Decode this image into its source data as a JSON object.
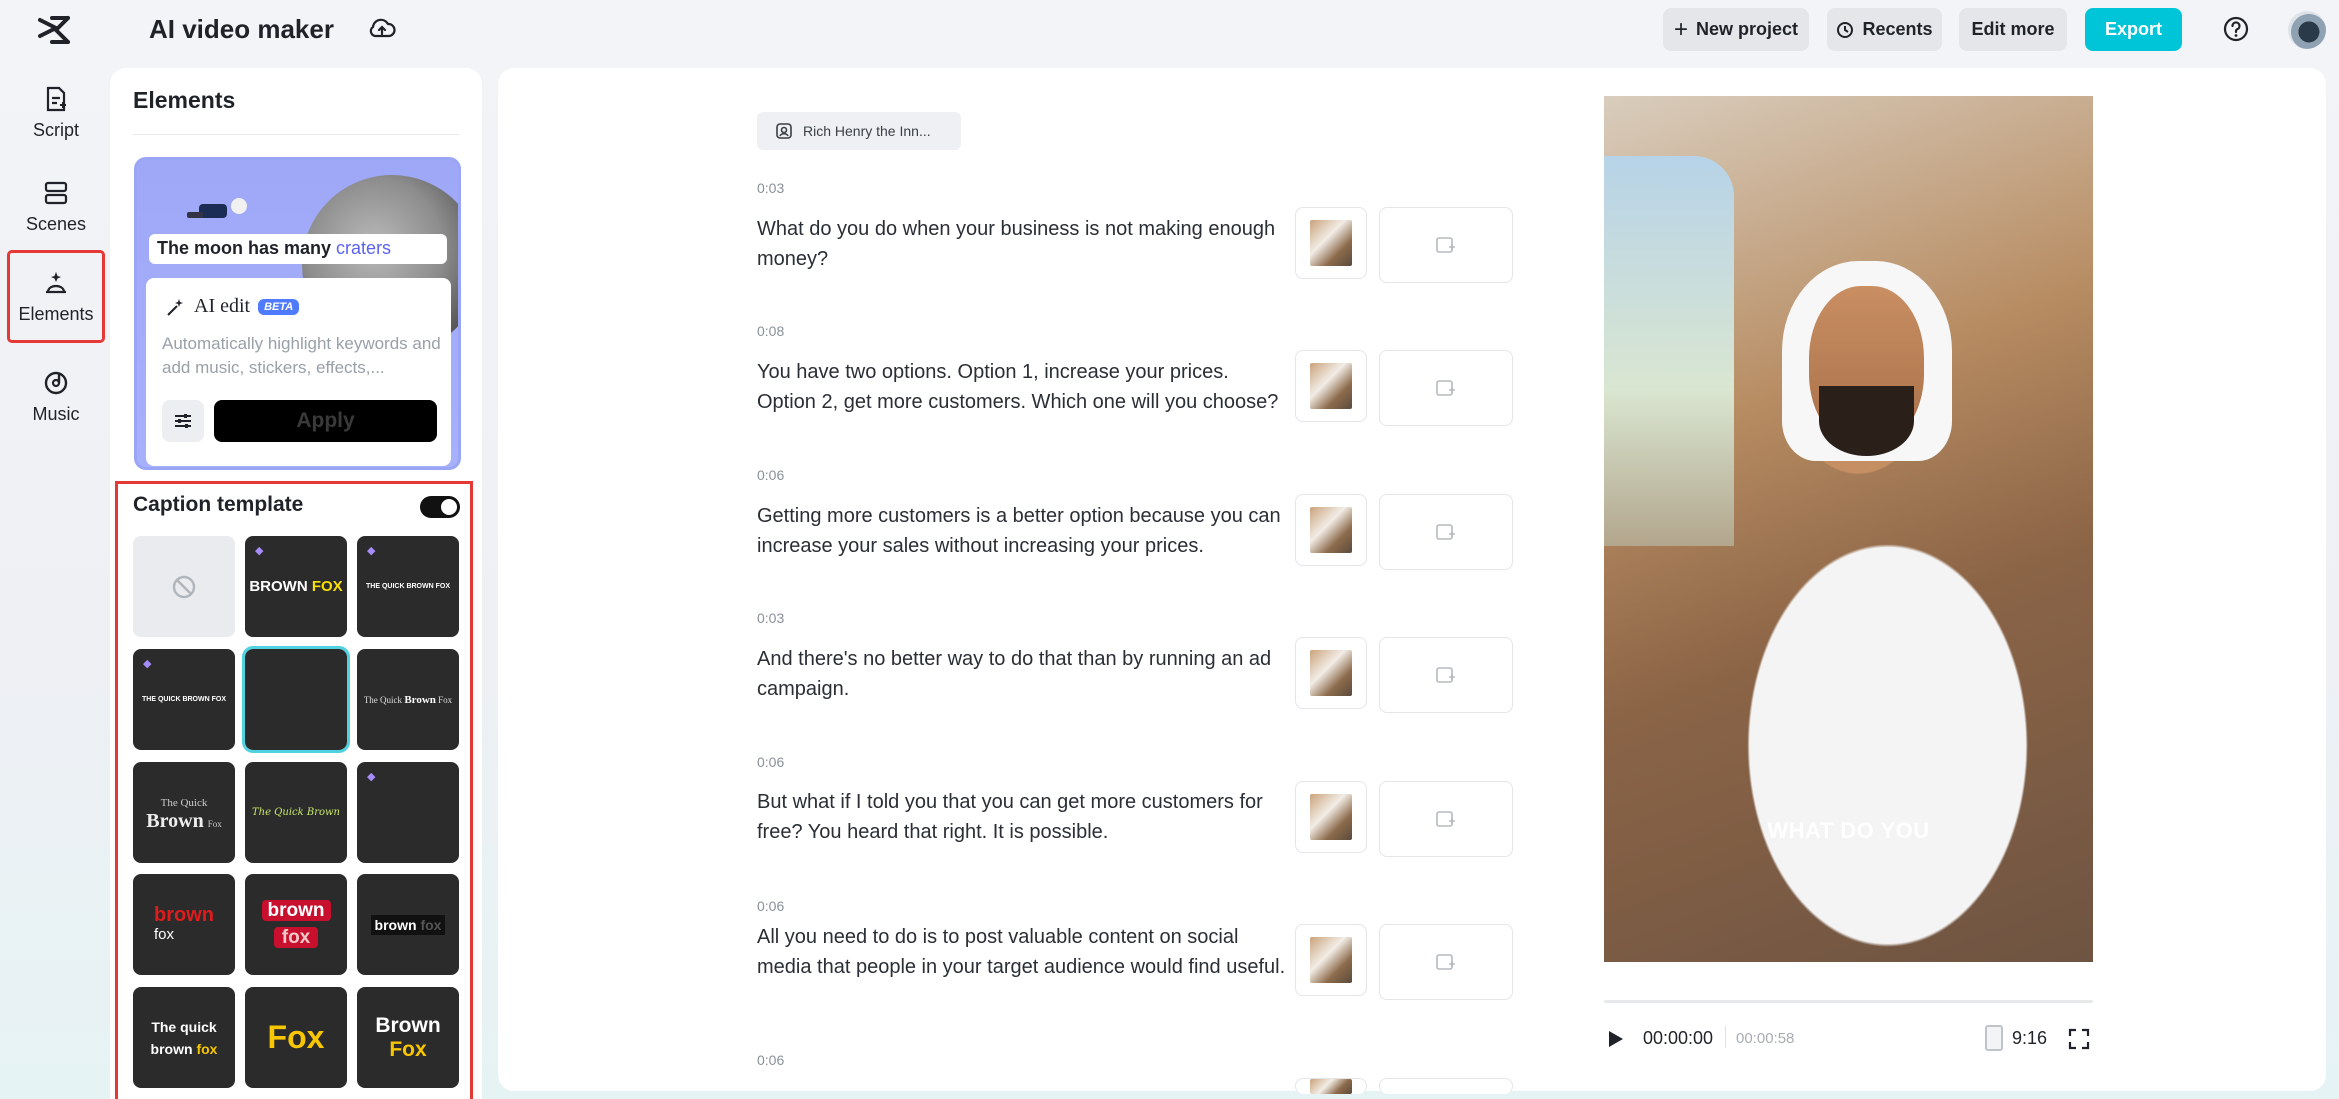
{
  "app": {
    "title": "AI video maker"
  },
  "topbar": {
    "new_project": "New project",
    "recents": "Recents",
    "edit_more": "Edit more",
    "export": "Export"
  },
  "rail": {
    "script": "Script",
    "scenes": "Scenes",
    "elements": "Elements",
    "music": "Music"
  },
  "elements_panel": {
    "title": "Elements",
    "ai_card": {
      "sample_text_before": "The moon has many ",
      "sample_text_highlight": "craters",
      "ai_edit_label": "AI edit",
      "beta_badge": "BETA",
      "description": "Automatically highlight keywords and add music, stickers, effects,...",
      "apply": "Apply"
    },
    "caption": {
      "title": "Caption template",
      "toggle_on": true,
      "templates": [
        {
          "label": "",
          "type": "none"
        },
        {
          "label": "BROWN FOX",
          "premium": true
        },
        {
          "label": "THE QUICK BROWN FOX",
          "premium": true
        },
        {
          "label": "THE QUICK BROWN FOX",
          "premium": true
        },
        {
          "label": "",
          "selected": true
        },
        {
          "label": "The Quick Brown Fox"
        },
        {
          "label": "The Quick Brown Fox"
        },
        {
          "label": "The Quick Brown"
        },
        {
          "label": "",
          "premium": true
        },
        {
          "label": "brown fox"
        },
        {
          "label": "brown fox"
        },
        {
          "label": "brown fox"
        },
        {
          "label": "The quick brown fox"
        },
        {
          "label": "Fox"
        },
        {
          "label": "Brown Fox"
        }
      ]
    }
  },
  "script": {
    "voice_chip": "Rich Henry the Inn...",
    "lines": [
      {
        "time": "0:03",
        "text": "What do you do when your business is not making enough money?"
      },
      {
        "time": "0:08",
        "text": "You have two options. Option 1, increase your prices. Option 2, get more customers. Which one will you choose?"
      },
      {
        "time": "0:06",
        "text": "Getting more customers is a better option because you can increase your sales without increasing your prices."
      },
      {
        "time": "0:03",
        "text": "And there's no better way to do that than by running an ad campaign."
      },
      {
        "time": "0:06",
        "text": "But what if I told you that you can get more customers for free? You heard that right. It is possible."
      },
      {
        "time": "0:06",
        "text": "All you need to do is to post valuable content on social media that people in your target audience would find useful."
      },
      {
        "time": "0:06",
        "text": ""
      }
    ]
  },
  "preview": {
    "caption": "WHAT DO YOU",
    "current_time": "00:00:00",
    "total_time": "00:00:58",
    "aspect_ratio": "9:16",
    "progress": 0.0
  },
  "colors": {
    "accent": "#00c4d8",
    "highlight": "#5c62f0",
    "annotation": "#e53935"
  }
}
